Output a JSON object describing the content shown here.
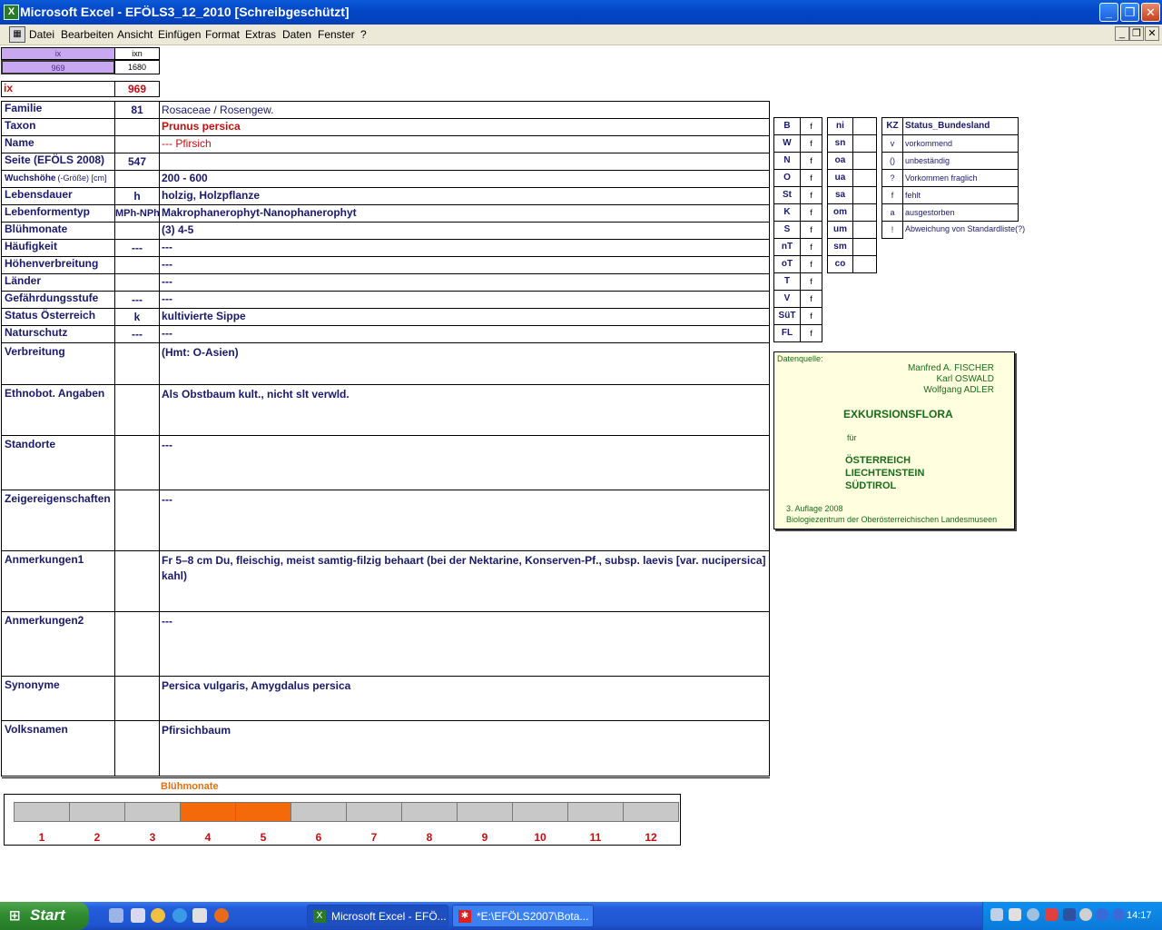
{
  "window": {
    "title": "Microsoft Excel - EFÖLS3_12_2010  [Schreibgeschützt]",
    "app_icon": "excel-icon"
  },
  "menu": [
    "Datei",
    "Bearbeiten",
    "Ansicht",
    "Einfügen",
    "Format",
    "Extras",
    "Daten",
    "Fenster",
    "?"
  ],
  "top": {
    "h1": "ix",
    "h2": "ixn",
    "v1": "969",
    "v2": "1680",
    "ix_label": "ix",
    "ix_value": "969"
  },
  "rows": [
    {
      "label": "Familie",
      "num": "81",
      "value": "Rosaceae  /  Rosengew."
    },
    {
      "label": "Taxon",
      "num": "",
      "value": "Prunus persica"
    },
    {
      "label": "Name",
      "num": "",
      "value": "--- Pfirsich"
    },
    {
      "label": "Seite (EFÖLS 2008)",
      "num": "547",
      "value": ""
    },
    {
      "label": "Wuchshöhe",
      "label_small": "(-Größe) [cm]",
      "num": "",
      "value": "200 - 600"
    },
    {
      "label": "Lebensdauer",
      "num": "h",
      "value": "holzig, Holzpflanze"
    },
    {
      "label": "Lebenformentyp",
      "num": "MPh-NPh",
      "value": "Makrophanerophyt-Nanophanerophyt"
    },
    {
      "label": "Blühmonate",
      "num": "",
      "value": "(3) 4-5"
    },
    {
      "label": "Häufigkeit",
      "num": "---",
      "value": "---"
    },
    {
      "label": "Höhenverbreitung",
      "num": "",
      "value": "---"
    },
    {
      "label": "Länder",
      "num": "",
      "value": "---"
    },
    {
      "label": "Gefährdungsstufe",
      "num": "---",
      "value": "---"
    },
    {
      "label": "Status Österreich",
      "num": "k",
      "value": "kultivierte Sippe"
    },
    {
      "label": "Naturschutz",
      "num": "---",
      "value": "---"
    }
  ],
  "big_rows": [
    {
      "label": "Verbreitung",
      "value": "(Hmt: O-Asien)"
    },
    {
      "label": "Ethnobot. Angaben",
      "value": "Als Obstbaum kult., nicht slt verwld."
    },
    {
      "label": "Standorte",
      "value": "---"
    },
    {
      "label": "Zeigereigenschaften",
      "value": "---"
    },
    {
      "label": "Anmerkungen1",
      "value": "Fr 5–8 cm Du, fleischig, meist samtig-filzig behaart (bei der Nektarine, Konserven-Pf., subsp. laevis [var. nucipersica]",
      "value2": "kahl)"
    },
    {
      "label": "Anmerkungen2",
      "value": "---"
    },
    {
      "label": "Synonyme",
      "value": "Persica vulgaris, Amygdalus persica"
    },
    {
      "label": "Volksnamen",
      "value": "Pfirsichbaum"
    }
  ],
  "regions1": [
    [
      "B",
      "f"
    ],
    [
      "W",
      "f"
    ],
    [
      "N",
      "f"
    ],
    [
      "O",
      "f"
    ],
    [
      "St",
      "f"
    ],
    [
      "K",
      "f"
    ],
    [
      "S",
      "f"
    ],
    [
      "nT",
      "f"
    ],
    [
      "oT",
      "f"
    ],
    [
      "T",
      "f"
    ],
    [
      "V",
      "f"
    ],
    [
      "SüT",
      "f"
    ],
    [
      "FL",
      "f"
    ]
  ],
  "regions2": [
    "ni",
    "sn",
    "oa",
    "ua",
    "sa",
    "om",
    "um",
    "sm",
    "co"
  ],
  "status_legend": {
    "header_kz": "KZ",
    "header_label": "Status_Bundesland",
    "items": [
      [
        "v",
        "vorkommend"
      ],
      [
        "()",
        "unbeständig"
      ],
      [
        "?",
        "Vorkommen fraglich"
      ],
      [
        "f",
        "fehlt"
      ],
      [
        "a",
        "ausgestorben"
      ],
      [
        "!",
        "Abweichung von Standardliste(?)"
      ]
    ]
  },
  "source": {
    "heading": "Datenquelle:",
    "authors": [
      "Manfred A. FISCHER",
      "Karl OSWALD",
      "Wolfgang ADLER"
    ],
    "title": "EXKURSIONSFLORA",
    "fuer": "für",
    "regions": [
      "ÖSTERREICH",
      "LIECHTENSTEIN",
      "SÜDTIROL"
    ],
    "edition": "3. Auflage 2008",
    "publisher": "Biologiezentrum der Oberösterreichischen Landesmuseen"
  },
  "bloom": {
    "title": "Blühmonate",
    "months": [
      "1",
      "2",
      "3",
      "4",
      "5",
      "6",
      "7",
      "8",
      "9",
      "10",
      "11",
      "12"
    ],
    "active": [
      4,
      5
    ],
    "active_color": "#f46a0a",
    "inactive_color": "#c8c8c8"
  },
  "taskbar": {
    "start": "Start",
    "tasks": [
      "Microsoft Excel - EFÖ...",
      "*E:\\EFÖLS2007\\Bota..."
    ],
    "clock": "14:17"
  }
}
